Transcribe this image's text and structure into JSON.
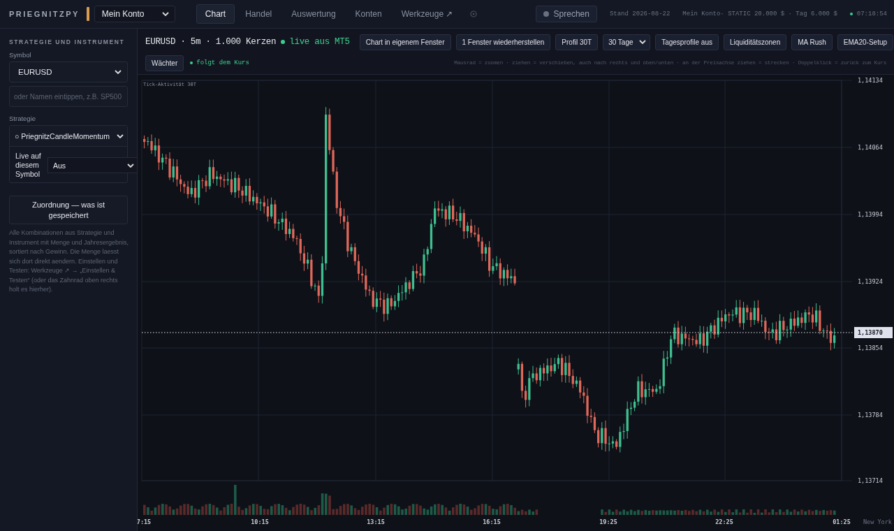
{
  "brand": "PRIEGNITZPY",
  "account_select": {
    "value": "Mein Konto"
  },
  "nav_tabs": [
    {
      "label": "Chart",
      "selected": true
    },
    {
      "label": "Handel",
      "selected": false
    },
    {
      "label": "Auswertung",
      "selected": false
    },
    {
      "label": "Konten",
      "selected": false
    },
    {
      "label": "Werkzeuge ↗",
      "selected": false
    }
  ],
  "speak_button": {
    "label": "Sprechen"
  },
  "status": {
    "date": "Stand 2026-08-22",
    "account": "Mein Konto· STATIC 20.000 $ · Tag 6.000 $",
    "time": "07:18:54"
  },
  "sidebar": {
    "heading": "STRATEGIE UND INSTRUMENT",
    "symbol_label": "Symbol",
    "symbol_value": "EURUSD",
    "search_placeholder": "oder Namen eintippen, z.B. SP500",
    "strategy_label": "Strategie",
    "strategy_value": "○ PriegnitzCandleMomentum",
    "live_label": "Live auf diesem Symbol",
    "live_value": "Aus",
    "mapping_button": "Zuordnung — was ist gespeichert",
    "help_text": "Alle Kombinationen aus Strategie und Instrument mit Menge und Jahresergebnis, sortiert nach Gewinn. Die Menge laesst sich dort direkt aendern. Einstellen und Testen: Werkzeuge ↗ → „Einstellen & Testen“ (oder das Zahnrad oben rechts holt es hierher)."
  },
  "toolbar": {
    "title": "EURUSD · 5m · 1.000 Kerzen",
    "live": "live aus MT5",
    "buttons": [
      {
        "kind": "button",
        "label": "Chart in eigenem Fenster"
      },
      {
        "kind": "button",
        "label": "1 Fenster wiederherstellen"
      },
      {
        "kind": "button",
        "label": "Profil 30T"
      },
      {
        "kind": "select",
        "label": "30 Tage"
      },
      {
        "kind": "button",
        "label": "Tagesprofile aus"
      },
      {
        "kind": "button",
        "label": "Liquiditätszonen"
      },
      {
        "kind": "button",
        "label": "MA Rush"
      },
      {
        "kind": "button",
        "label": "EMA20-Setup"
      }
    ],
    "watcher_button": "Wächter",
    "follow": "folgt dem Kurs",
    "hint": "Mausrad = zoomen · ziehen = verschieben, auch nach rechts und oben/unten · an der Preisachse ziehen = strecken · Doppelklick = zurück zum Kurs"
  },
  "chart": {
    "caption": "Tick-Aktivität 30T",
    "price_ticks": [
      "1,14134",
      "1,14064",
      "1,13994",
      "1,13924",
      "1,13854",
      "1,13784",
      "1,13714"
    ],
    "current_price": "1,13870",
    "time_ticks": [
      "7:15",
      "10:15",
      "13:15",
      "16:15",
      "19:25",
      "22:25",
      "01:25"
    ],
    "timezone": "New York"
  }
}
